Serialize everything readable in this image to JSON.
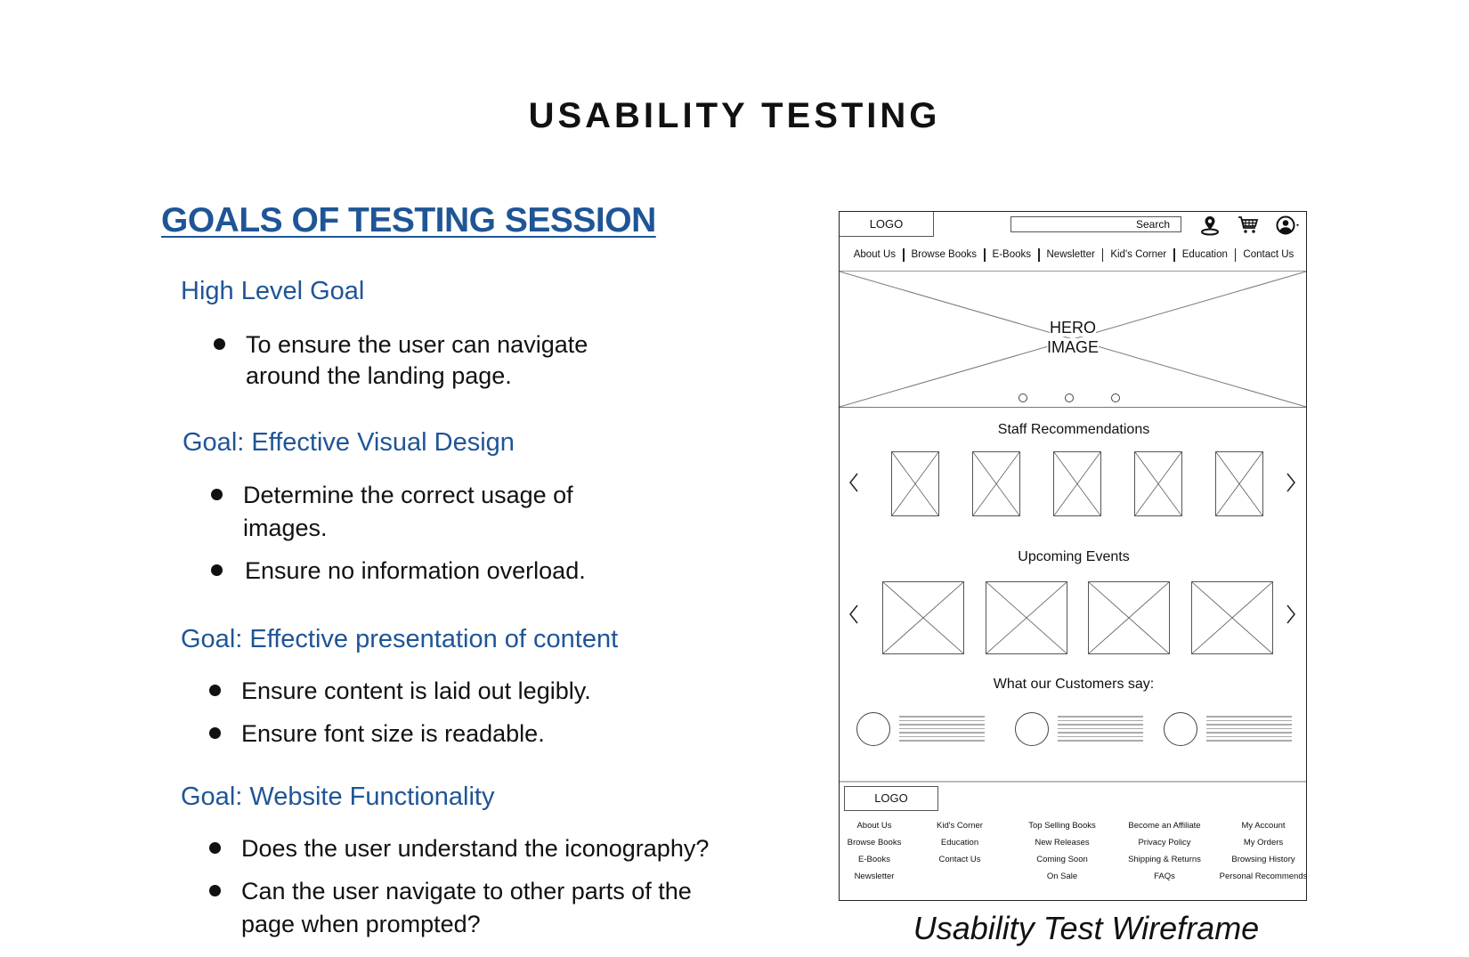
{
  "title": "USABILITY TESTING",
  "goals": {
    "heading": "GOALS OF TESTING SESSION",
    "sections": [
      {
        "heading": "High Level Goal",
        "bullets": [
          [
            "To ensure the user can navigate",
            "around the landing page."
          ]
        ]
      },
      {
        "heading": "Goal: Effective Visual Design",
        "bullets": [
          [
            "Determine the correct usage of",
            "images."
          ],
          [
            "Ensure no information overload."
          ]
        ]
      },
      {
        "heading": "Goal: Effective presentation of content",
        "bullets": [
          [
            "Ensure content is laid out legibly."
          ],
          [
            "Ensure font size is readable."
          ]
        ]
      },
      {
        "heading": "Goal: Website Functionality",
        "bullets": [
          [
            "Does the user understand the iconography?"
          ],
          [
            "Can the user navigate to other parts of the",
            "page when prompted?"
          ]
        ]
      }
    ]
  },
  "colors": {
    "heading_blue": "#1f5596",
    "text": "#111111"
  },
  "wireframe": {
    "logo": "LOGO",
    "search_placeholder": "Search",
    "icons": [
      "location-pin-icon",
      "shopping-cart-icon",
      "user-account-icon"
    ],
    "nav": [
      "About Us",
      "Browse Books",
      "E-Books",
      "Newsletter",
      "Kid's Corner",
      "Education",
      "Contact Us"
    ],
    "hero": {
      "line1": "HERO",
      "line2": "IMAGE",
      "dots": 3
    },
    "staff_title": "Staff Recommendations",
    "staff_count": 5,
    "events_title": "Upcoming Events",
    "events_count": 4,
    "customers_title": "What our Customers say:",
    "testimonials_count": 3,
    "footer": {
      "logo": "LOGO",
      "columns": [
        [
          "About Us",
          "Browse Books",
          "E-Books",
          "Newsletter"
        ],
        [
          "Kid's Corner",
          "Education",
          "Contact Us"
        ],
        [
          "Top Selling Books",
          "New Releases",
          "Coming Soon",
          "On Sale"
        ],
        [
          "Become an Affiliate",
          "Privacy Policy",
          "Shipping & Returns",
          "FAQs"
        ],
        [
          "My Account",
          "My Orders",
          "Browsing History",
          "Personal Recommends"
        ]
      ]
    }
  },
  "caption": "Usability Test Wireframe"
}
